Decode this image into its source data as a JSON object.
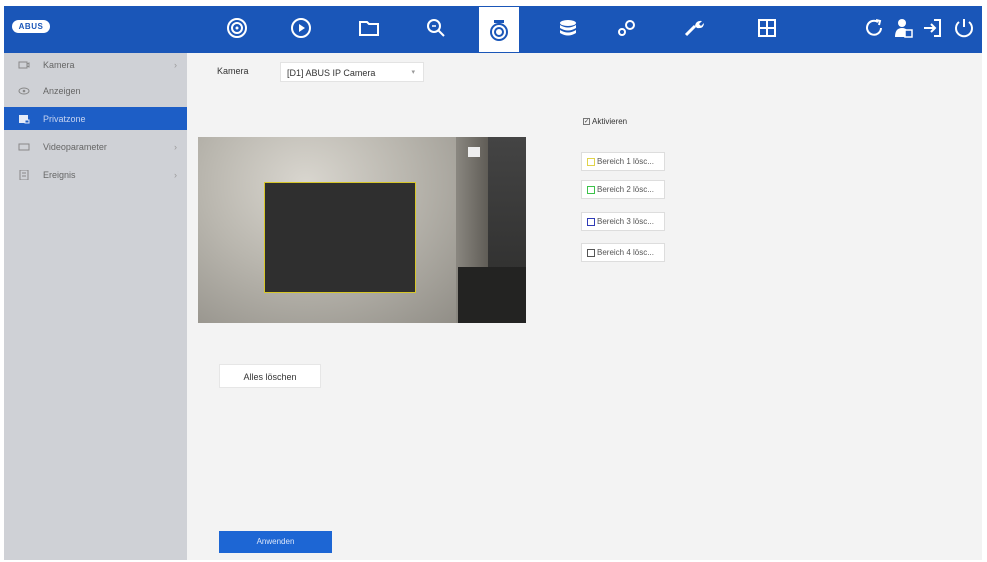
{
  "brand": {
    "logo_text": "ABUS"
  },
  "toolbar": {
    "icons": [
      "live-view-icon",
      "playback-icon",
      "file-management-icon",
      "search-icon",
      "camera-icon",
      "storage-icon",
      "system-settings-icon",
      "maintenance-icon",
      "layout-icon"
    ],
    "active": "camera-icon",
    "right_icons": [
      "refresh-icon",
      "user-icon",
      "logout-icon",
      "power-icon"
    ]
  },
  "sidebar": {
    "items": [
      {
        "label": "Kamera",
        "icon": "camera-icon",
        "chevron": "›"
      },
      {
        "label": "Anzeigen",
        "icon": "eye-icon",
        "chevron": ""
      },
      {
        "label": "Privatzone",
        "icon": "privacy-icon",
        "chevron": ""
      },
      {
        "label": "Videoparameter",
        "icon": "video-icon",
        "chevron": "›"
      },
      {
        "label": "Ereignis",
        "icon": "event-icon",
        "chevron": "›"
      }
    ],
    "active_index": 2
  },
  "main": {
    "camera_label": "Kamera",
    "camera_value": "[D1] ABUS IP Camera",
    "enable_label": "Aktivieren",
    "enable_checked": true,
    "areas": [
      {
        "label": "Bereich 1 lösc...",
        "color": "#e0d34a"
      },
      {
        "label": "Bereich 2 lösc...",
        "color": "#3cc24a"
      },
      {
        "label": "Bereich 3 lösc...",
        "color": "#2f3bb8"
      },
      {
        "label": "Bereich 4 lösc...",
        "color": "#555555"
      }
    ],
    "clear_all_label": "Alles löschen",
    "apply_label": "Anwenden"
  },
  "colors": {
    "brand_blue": "#1a56b8",
    "accent_blue": "#1d66d4",
    "sidebar_bg": "#cfd1d6"
  }
}
